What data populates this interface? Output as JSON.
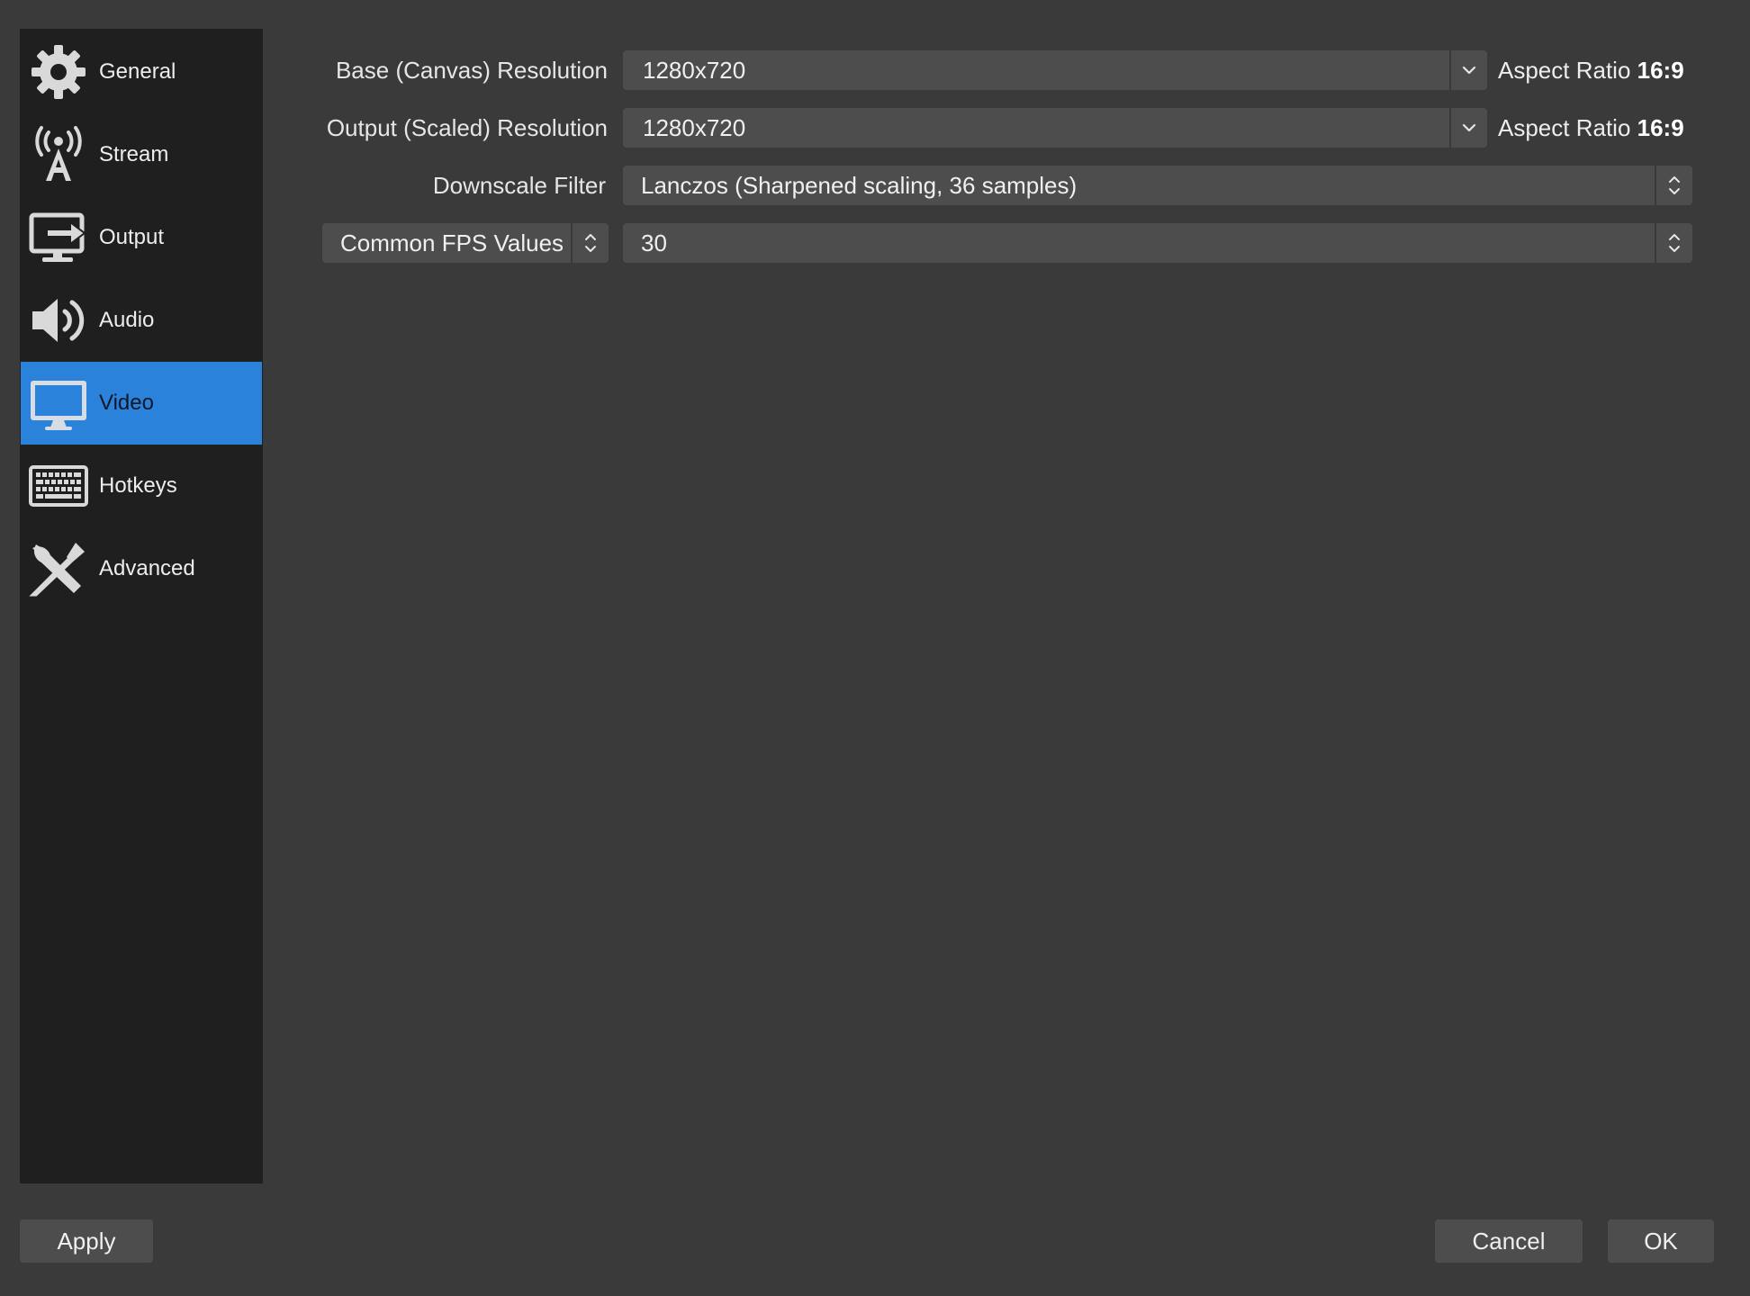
{
  "sidebar": {
    "items": [
      {
        "label": "General",
        "icon": "gear-icon"
      },
      {
        "label": "Stream",
        "icon": "antenna-icon"
      },
      {
        "label": "Output",
        "icon": "output-monitor-icon"
      },
      {
        "label": "Audio",
        "icon": "speaker-icon"
      },
      {
        "label": "Video",
        "icon": "monitor-icon",
        "active": true
      },
      {
        "label": "Hotkeys",
        "icon": "keyboard-icon"
      },
      {
        "label": "Advanced",
        "icon": "tools-icon"
      }
    ],
    "active_color": "#2a82da"
  },
  "video": {
    "base_resolution": {
      "label": "Base (Canvas) Resolution",
      "value": "1280x720",
      "aspect_prefix": "Aspect Ratio",
      "aspect_value": "16:9"
    },
    "output_resolution": {
      "label": "Output (Scaled) Resolution",
      "value": "1280x720",
      "aspect_prefix": "Aspect Ratio",
      "aspect_value": "16:9"
    },
    "downscale_filter": {
      "label": "Downscale Filter",
      "value": "Lanczos (Sharpened scaling, 36 samples)"
    },
    "fps": {
      "type_label": "Common FPS Values",
      "value": "30"
    }
  },
  "buttons": {
    "apply": "Apply",
    "cancel": "Cancel",
    "ok": "OK"
  }
}
